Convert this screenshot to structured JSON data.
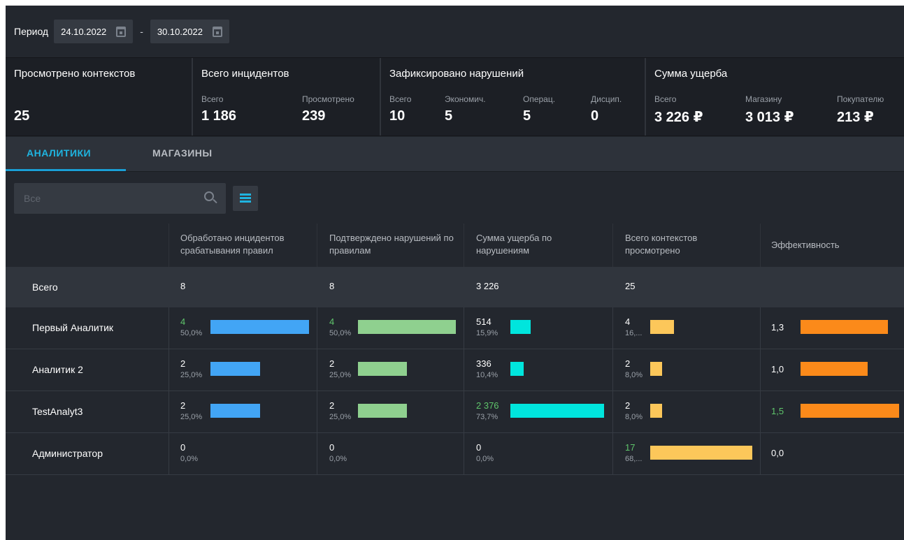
{
  "period": {
    "label": "Период",
    "date_from": "24.10.2022",
    "separator": "-",
    "date_to": "30.10.2022"
  },
  "stats": {
    "contexts": {
      "title": "Просмотрено контекстов",
      "value": "25"
    },
    "incidents": {
      "title": "Всего инцидентов",
      "total_label": "Всего",
      "total": "1 186",
      "viewed_label": "Просмотрено",
      "viewed": "239"
    },
    "violations": {
      "title": "Зафиксировано нарушений",
      "total_label": "Всего",
      "total": "10",
      "econ_label": "Экономич.",
      "econ": "5",
      "oper_label": "Операц.",
      "oper": "5",
      "disc_label": "Дисцип.",
      "disc": "0"
    },
    "damage": {
      "title": "Сумма ущерба",
      "total_label": "Всего",
      "total": "3 226 ₽",
      "store_label": "Магазину",
      "store": "3 013 ₽",
      "buyer_label": "Покупателю",
      "buyer": "213 ₽"
    }
  },
  "tabs": [
    {
      "label": "АНАЛИТИКИ",
      "active": true
    },
    {
      "label": "МАГАЗИНЫ",
      "active": false
    }
  ],
  "search": {
    "placeholder": "Все"
  },
  "table": {
    "headers": {
      "incidents": "Обработано инцидентов срабатывания правил",
      "violations": "Подтверждено нарушений по правилам",
      "damage": "Сумма ущерба по нарушениям",
      "contexts": "Всего контекстов просмотрено",
      "efficiency": "Эффективность"
    },
    "total": {
      "name": "Всего",
      "incidents": "8",
      "violations": "8",
      "damage": "3 226",
      "contexts": "25"
    },
    "rows": [
      {
        "name": "Первый Аналитик",
        "incidents": "4",
        "incidents_pct": "50,0%",
        "incidents_frac": 1.0,
        "violations": "4",
        "violations_pct": "50,0%",
        "violations_frac": 1.0,
        "damage": "514",
        "damage_pct": "15,9%",
        "damage_frac": 0.216,
        "contexts": "4",
        "contexts_pct": "16,...",
        "contexts_frac": 0.235,
        "efficiency": "1,3",
        "efficiency_frac": 0.883
      },
      {
        "name": "Аналитик 2",
        "incidents": "2",
        "incidents_pct": "25,0%",
        "incidents_frac": 0.5,
        "violations": "2",
        "violations_pct": "25,0%",
        "violations_frac": 0.5,
        "damage": "336",
        "damage_pct": "10,4%",
        "damage_frac": 0.141,
        "contexts": "2",
        "contexts_pct": "8,0%",
        "contexts_frac": 0.118,
        "efficiency": "1,0",
        "efficiency_frac": 0.679
      },
      {
        "name": "TestAnalyt3",
        "incidents": "2",
        "incidents_pct": "25,0%",
        "incidents_frac": 0.5,
        "violations": "2",
        "violations_pct": "25,0%",
        "violations_frac": 0.5,
        "damage": "2 376",
        "damage_pct": "73,7%",
        "damage_frac": 1.0,
        "contexts": "2",
        "contexts_pct": "8,0%",
        "contexts_frac": 0.118,
        "efficiency": "1,5",
        "efficiency_frac": 1.0
      },
      {
        "name": "Администратор",
        "incidents": "0",
        "incidents_pct": "0,0%",
        "incidents_frac": 0,
        "violations": "0",
        "violations_pct": "0,0%",
        "violations_frac": 0,
        "damage": "0",
        "damage_pct": "0,0%",
        "damage_frac": 0,
        "contexts": "17",
        "contexts_pct": "68,...",
        "contexts_frac": 1.0,
        "efficiency": "0,0",
        "efficiency_frac": 0
      }
    ],
    "highlight": {
      "incidents": [
        true,
        false,
        false,
        false
      ],
      "violations": [
        true,
        false,
        false,
        false
      ],
      "damage": [
        false,
        false,
        true,
        false
      ],
      "contexts": [
        false,
        false,
        false,
        true
      ],
      "efficiency": [
        false,
        false,
        true,
        false
      ]
    }
  },
  "colors": {
    "incidents": "#42a5f5",
    "violations": "#8fd08f",
    "damage": "#00e5dd",
    "contexts": "#fcc75a",
    "efficiency": "#fb8a1a"
  }
}
